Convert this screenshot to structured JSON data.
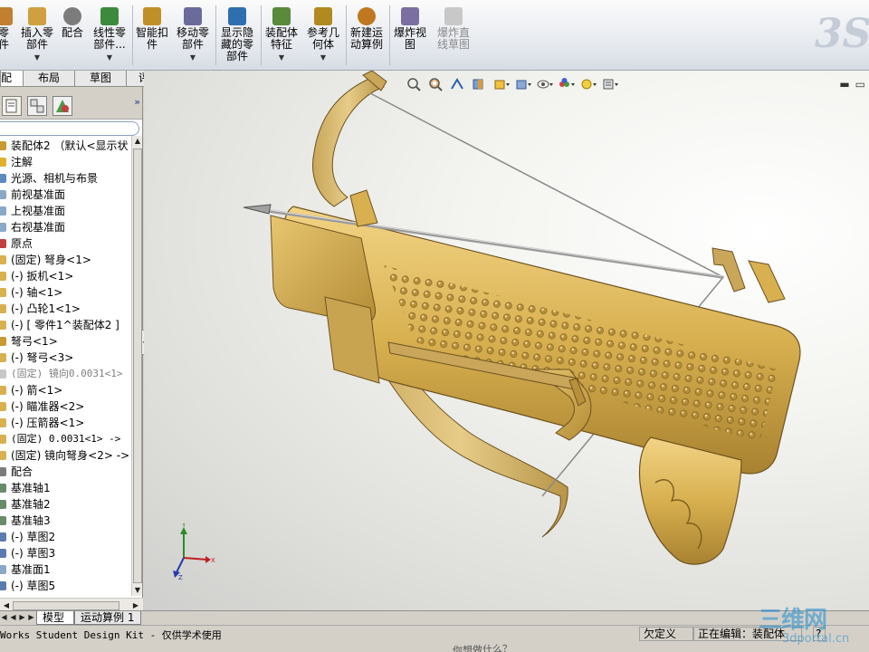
{
  "ribbon": {
    "buttons": [
      {
        "label": "零\n件",
        "dropdown": false,
        "disabled": false,
        "color": "#c08030"
      },
      {
        "label": "插入零\n部件",
        "dropdown": true,
        "disabled": false,
        "color": "#d0a040"
      },
      {
        "label": "配合",
        "dropdown": false,
        "disabled": false,
        "color": "#7c7c7c"
      },
      {
        "label": "线性零\n部件...",
        "dropdown": true,
        "disabled": false,
        "color": "#3c8a3c"
      },
      {
        "label": "智能扣\n件",
        "dropdown": false,
        "disabled": false,
        "color": "#c09028"
      },
      {
        "label": "移动零\n部件",
        "dropdown": true,
        "disabled": false,
        "color": "#6b6b9b"
      },
      {
        "label": "显示隐\n藏的零\n部件",
        "dropdown": false,
        "disabled": false,
        "color": "#2f6fb0"
      },
      {
        "label": "装配体\n特征",
        "dropdown": true,
        "disabled": false,
        "color": "#5a8a3a"
      },
      {
        "label": "参考几\n何体",
        "dropdown": true,
        "disabled": false,
        "color": "#b08a20"
      },
      {
        "label": "新建运\n动算例",
        "dropdown": false,
        "disabled": false,
        "color": "#c07820"
      },
      {
        "label": "爆炸视\n图",
        "dropdown": false,
        "disabled": false,
        "color": "#7a6fa0"
      },
      {
        "label": "爆炸直\n线草图",
        "dropdown": false,
        "disabled": true,
        "color": "#a8a8a8"
      }
    ],
    "logo": "3S"
  },
  "cm_tabs": [
    "配体",
    "布局",
    "草图",
    "评估"
  ],
  "feature_tree": {
    "items": [
      {
        "label": "装配体2 （默认<显示状",
        "icon_color": "#c99a30",
        "dim": false
      },
      {
        "label": "注解",
        "icon_color": "#e0b030",
        "dim": false
      },
      {
        "label": "光源、相机与布景",
        "icon_color": "#5a8ac0",
        "dim": false
      },
      {
        "label": "前视基准面",
        "icon_color": "#8aa8c8",
        "dim": false
      },
      {
        "label": "上视基准面",
        "icon_color": "#8aa8c8",
        "dim": false
      },
      {
        "label": "右视基准面",
        "icon_color": "#8aa8c8",
        "dim": false
      },
      {
        "label": "原点",
        "icon_color": "#c04040",
        "dim": false
      },
      {
        "label": "(固定) 弩身<1>",
        "icon_color": "#d8b050",
        "dim": false
      },
      {
        "label": "(-) 扳机<1>",
        "icon_color": "#d8b050",
        "dim": false
      },
      {
        "label": "(-) 轴<1>",
        "icon_color": "#d8b050",
        "dim": false
      },
      {
        "label": "(-) 凸轮1<1>",
        "icon_color": "#d8b050",
        "dim": false
      },
      {
        "label": "(-) [ 零件1^装配体2 ]",
        "icon_color": "#d8b050",
        "dim": false
      },
      {
        "label": "弩弓<1>",
        "icon_color": "#c99a30",
        "dim": false
      },
      {
        "label": "(-) 弩弓<3>",
        "icon_color": "#d8b050",
        "dim": false
      },
      {
        "label": "(固定) 镜向0.0031<1>",
        "icon_color": "#c8c8c8",
        "dim": true
      },
      {
        "label": "(-) 箭<1>",
        "icon_color": "#d8b050",
        "dim": false
      },
      {
        "label": "(-) 瞄准器<2>",
        "icon_color": "#d8b050",
        "dim": false
      },
      {
        "label": "(-) 压箭器<1>",
        "icon_color": "#d8b050",
        "dim": false
      },
      {
        "label": "(固定) 0.0031<1> ->",
        "icon_color": "#d8b050",
        "dim": false
      },
      {
        "label": "(固定) 镜向弩身<2> ->",
        "icon_color": "#d8b050",
        "dim": false
      },
      {
        "label": "配合",
        "icon_color": "#7c7c7c",
        "dim": false
      },
      {
        "label": "基准轴1",
        "icon_color": "#6a8a6a",
        "dim": false
      },
      {
        "label": "基准轴2",
        "icon_color": "#6a8a6a",
        "dim": false
      },
      {
        "label": "基准轴3",
        "icon_color": "#6a8a6a",
        "dim": false
      },
      {
        "label": "(-) 草图2",
        "icon_color": "#5a7ab0",
        "dim": false
      },
      {
        "label": "(-) 草图3",
        "icon_color": "#5a7ab0",
        "dim": false
      },
      {
        "label": "基准面1",
        "icon_color": "#8aa8c8",
        "dim": false
      },
      {
        "label": "(-) 草图5",
        "icon_color": "#5a7ab0",
        "dim": false
      }
    ]
  },
  "bottom_tabs": [
    "模型",
    "运动算例 1"
  ],
  "status": {
    "main": "Works Student Design Kit - 仅供学术使用",
    "underdefined": "欠定义",
    "editing": "正在编辑：装配体",
    "help": "?",
    "scroll_text": "你想做什么？"
  },
  "watermark": {
    "big": "三维网",
    "small": "3dportal.cn"
  },
  "colors": {
    "ribbon_top": "#fbfbfb",
    "body_gold": "#d8b050",
    "body_shadow": "#8a6a20",
    "string": "#8a8a8a"
  },
  "heads_up_icons": [
    "zoom-to-fit-icon",
    "zoom-area-icon",
    "previous-view-icon",
    "section-view-icon",
    "view-orientation-icon",
    "display-style-icon",
    "hide-show-items-icon",
    "edit-appearance-icon",
    "apply-scene-icon",
    "view-settings-icon"
  ]
}
